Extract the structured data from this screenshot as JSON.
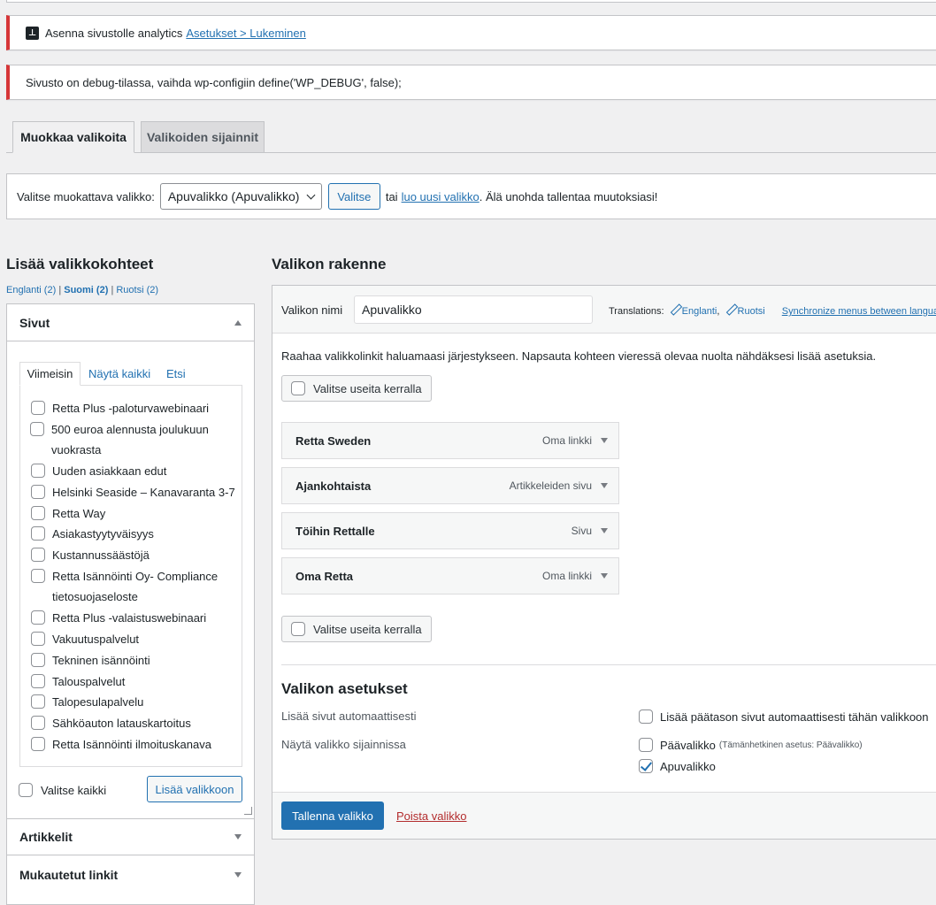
{
  "notices": {
    "analytics_text": "Asenna sivustolle analytics",
    "analytics_link": "Asetukset > Lukeminen",
    "debug_text": "Sivusto on debug-tilassa, vaihda wp-configiin define('WP_DEBUG', false);"
  },
  "tabs": [
    {
      "label": "Muokkaa valikoita"
    },
    {
      "label": "Valikoiden sijainnit"
    }
  ],
  "select_bar": {
    "label": "Valitse muokattava valikko:",
    "selected": "Apuvalikko (Apuvalikko)",
    "button": "Valitse",
    "or": "tai",
    "new_link": "luo uusi valikko",
    "reminder": ". Älä unohda tallentaa muutoksiasi!"
  },
  "left": {
    "heading": "Lisää valikkokohteet",
    "languages": [
      {
        "label": "Englanti (2)"
      },
      {
        "label": "Suomi (2)"
      },
      {
        "label": "Ruotsi (2)"
      }
    ],
    "pages_section": "Sivut",
    "subtabs": [
      "Viimeisin",
      "Näytä kaikki",
      "Etsi"
    ],
    "pages": [
      "Retta Plus -paloturvawebinaari",
      "500 euroa alennusta joulukuun vuokrasta",
      "Uuden asiakkaan edut",
      "Helsinki Seaside – Kanavaranta 3-7",
      "Retta Way",
      "Asiakastyytyväisyys",
      "Kustannussäästöjä",
      "Retta Isännöinti Oy- Compliance tietosuojaseloste",
      "Retta Plus -valaistuswebinaari",
      "Vakuutuspalvelut",
      "Tekninen isännöinti",
      "Talouspalvelut",
      "Talopesulapalvelu",
      "Sähköauton latauskartoitus",
      "Retta Isännöinti ilmoituskanava"
    ],
    "select_all": "Valitse kaikki",
    "add_button": "Lisää valikkoon",
    "articles_section": "Artikkelit",
    "custom_links_section": "Mukautetut linkit"
  },
  "structure": {
    "heading": "Valikon rakenne",
    "name_label": "Valikon nimi",
    "name_value": "Apuvalikko",
    "translations_label": "Translations:",
    "trans_en": "Englanti",
    "trans_sv": "Ruotsi",
    "sync_link": "Synchronize menus between languages",
    "instructions": "Raahaa valikkolinkit haluamaasi järjestykseen. Napsauta kohteen vieressä olevaa nuolta nähdäksesi lisää asetuksia.",
    "bulk_select": "Valitse useita kerralla",
    "items": [
      {
        "title": "Retta Sweden",
        "type": "Oma linkki"
      },
      {
        "title": "Ajankohtaista",
        "type": "Artikkeleiden sivu"
      },
      {
        "title": "Töihin Rettalle",
        "type": "Sivu"
      },
      {
        "title": "Oma Retta",
        "type": "Oma linkki"
      }
    ],
    "settings_heading": "Valikon asetukset",
    "auto_add_label": "Lisää sivut automaattisesti",
    "auto_add_option": "Lisää päätason sivut automaattisesti tähän valikkoon",
    "locations_label": "Näytä valikko sijainnissa",
    "location_primary": "Päävalikko",
    "location_primary_note": "(Tämänhetkinen asetus: Päävalikko)",
    "location_secondary": "Apuvalikko",
    "save_button": "Tallenna valikko",
    "delete_link": "Poista valikko"
  }
}
